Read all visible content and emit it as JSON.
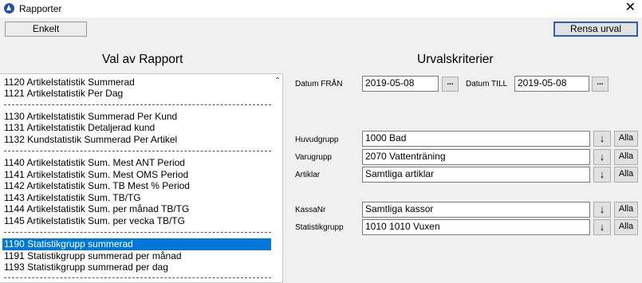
{
  "window": {
    "title": "Rapporter",
    "close_glyph": "✕"
  },
  "toolbar": {
    "tab_label": "Enkelt",
    "clear_label": "Rensa urval"
  },
  "headings": {
    "reports": "Val av Rapport",
    "criteria": "Urvalskriterier"
  },
  "reports": [
    "1120 Artikelstatistik Summerad",
    "1121 Artikelstatistik Per Dag",
    "1130 Artikelstatistik Summerad Per Kund",
    "1131 Artikelstatistik Detaljerad kund",
    "1132 Kundstatistik Summerad Per Artikel",
    "1140 Artikelstatistik Sum. Mest ANT Period",
    "1141 Artikelstatistik Sum. Mest OMS Period",
    "1142 Artikelstatistik Sum. TB Mest % Period",
    "1143 Artikelstatistik Sum. TB/TG",
    "1144 Artikelstatistik Sum. per månad TB/TG",
    "1145 Artikelstatistik Sum. per vecka TB/TG",
    "1190 Statistikgrupp summerad",
    "1191 Statistikgrupp summerad per månad",
    "1193 Statistikgrupp summerad per dag"
  ],
  "selected_report": "1190 Statistikgrupp summerad",
  "dates": {
    "from_label": "Datum FRÅN",
    "from_value": "2019-05-08",
    "to_label": "Datum TILL",
    "to_value": "2019-05-08",
    "picker_glyph": "..."
  },
  "criteria": {
    "arrow_glyph": "↓",
    "all_label": "Alla",
    "huvudgrupp": {
      "label": "Huvudgrupp",
      "value": "1000 Bad"
    },
    "varugrupp": {
      "label": "Varugrupp",
      "value": "2070 Vattenträning"
    },
    "artiklar": {
      "label": "Artiklar",
      "value": "Samtliga artiklar"
    },
    "kassanr": {
      "label": "KassaNr",
      "value": "Samtliga kassor"
    },
    "statistikgrupp": {
      "label": "Statistikgrupp",
      "value": "1010 1010 Vuxen"
    }
  },
  "colors": {
    "selection": "#0078d7",
    "focus_border": "#2a5fb5"
  },
  "icons": {
    "app": "app-logo-icon",
    "close": "close-icon",
    "scroll": "scroll-up-icon"
  }
}
